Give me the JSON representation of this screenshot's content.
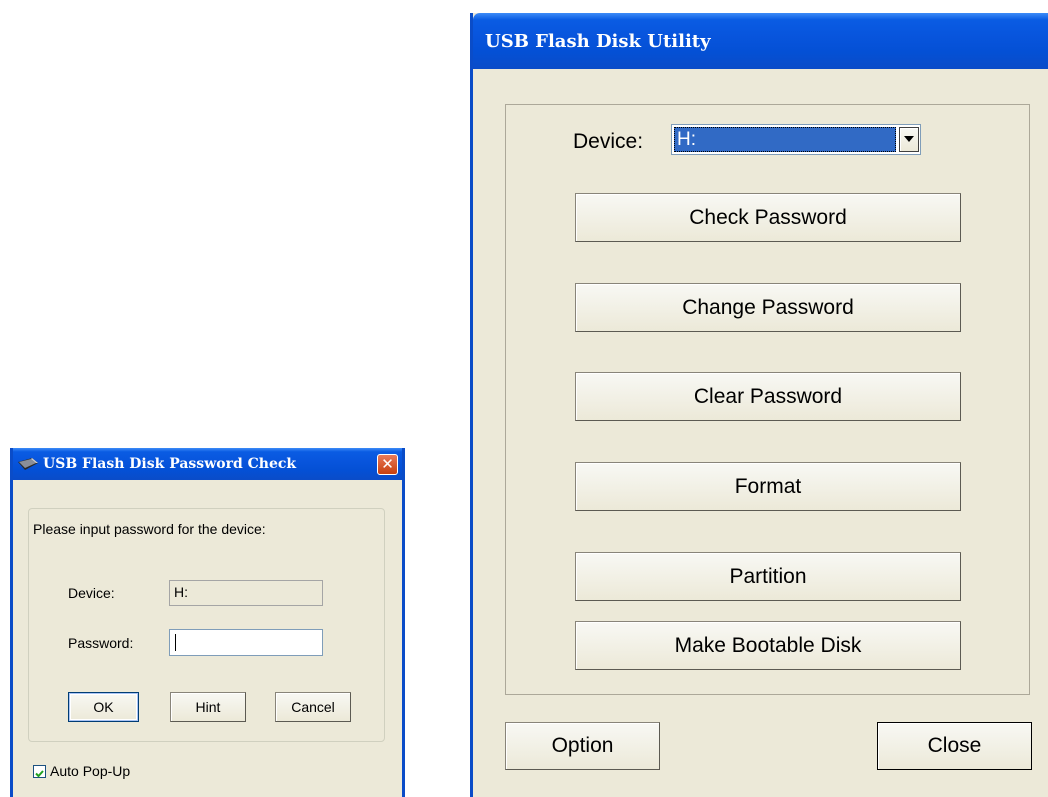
{
  "password_dialog": {
    "title": "USB Flash Disk Password Check",
    "prompt": "Please input password for the device:",
    "device_label": "Device:",
    "device_value": "H:",
    "password_label": "Password:",
    "password_value": "",
    "ok_label": "OK",
    "hint_label": "Hint",
    "cancel_label": "Cancel",
    "auto_popup_label": "Auto Pop-Up",
    "auto_popup_checked": true
  },
  "utility_window": {
    "title": "USB Flash Disk Utility",
    "device_label": "Device:",
    "device_selected": "H:",
    "buttons": {
      "check_password": "Check Password",
      "change_password": "Change Password",
      "clear_password": "Clear Password",
      "format": "Format",
      "partition": "Partition",
      "make_bootable": "Make Bootable Disk"
    },
    "option_label": "Option",
    "close_label": "Close"
  },
  "colors": {
    "titlebar_blue": "#0a5ce3",
    "window_face": "#ece9d8",
    "selection_blue": "#316ac5",
    "close_red": "#c8400f"
  },
  "icons": {
    "usb_icon": "usb-drive-icon",
    "close": "close-icon",
    "dropdown": "chevron-down-icon",
    "check": "checkmark-icon"
  }
}
